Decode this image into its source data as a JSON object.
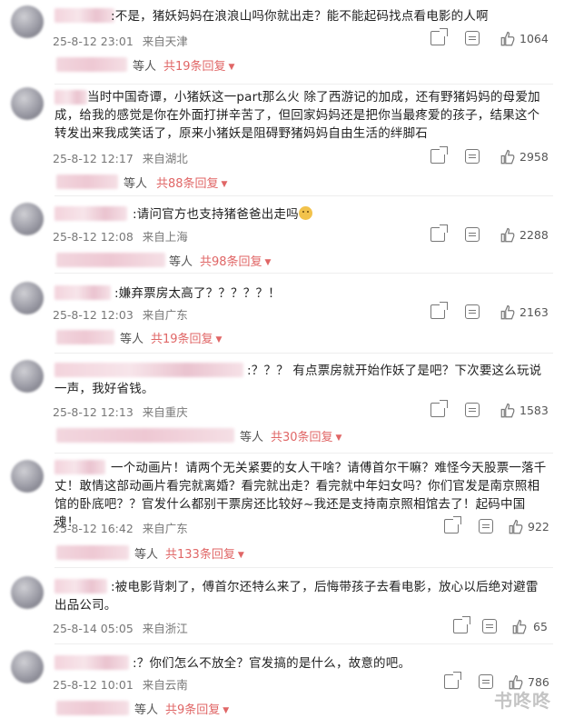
{
  "reply_others_label": "等人",
  "watermark": "书咚咚",
  "comments": [
    {
      "text": ":不是，猪妖妈妈在浪浪山吗你就出走？能不能起码找点看电影的人啊",
      "date": "25-8-12 23:01",
      "location": "来自天津",
      "likes": "1064",
      "replies": "共19条回复"
    },
    {
      "text": "当时中国奇谭，小猪妖这一part那么火 除了西游记的加成，还有野猪妈妈的母爱加成，给我的感觉是你在外面打拼辛苦了，但回家妈妈还是把你当最疼爱的孩子，结果这个转发出来我成笑话了，原来小猪妖是阻碍野猪妈妈自由生活的绊脚石",
      "date": "25-8-12 12:17",
      "location": "来自湖北",
      "likes": "2958",
      "replies": "共88条回复"
    },
    {
      "text": ":请问官方也支持猪爸爸出走吗",
      "date": "25-8-12 12:08",
      "location": "来自上海",
      "likes": "2288",
      "replies": "共98条回复"
    },
    {
      "text": ":嫌弃票房太高了？？？？？！",
      "date": "25-8-12 12:03",
      "location": "来自广东",
      "likes": "2163",
      "replies": "共19条回复"
    },
    {
      "text": ":？？？ 有点票房就开始作妖了是吧？下次要这么玩说一声，我好省钱。",
      "date": "25-8-12 12:13",
      "location": "来自重庆",
      "likes": "1583",
      "replies": "共30条回复"
    },
    {
      "text": "一个动画片！请两个无关紧要的女人干啥？请傅首尔干嘛？难怪今天股票一落千丈！敢情这部动画片看完就离婚？看完就出走？看完就中年妇女吗？你们官发是南京照相馆的卧底吧？？官发什么都别干票房还比较好~我还是支持南京照相馆去了！起码中国魂！",
      "date": "25-8-12 16:42",
      "location": "来自广东",
      "likes": "922",
      "replies": "共133条回复"
    },
    {
      "text": ":被电影背刺了，傅首尔还特么来了，后悔带孩子去看电影，放心以后绝对避雷出品公司。",
      "date": "25-8-14 05:05",
      "location": "来自浙江",
      "likes": "65",
      "replies": ""
    },
    {
      "text": ":？你们怎么不放全？官发搞的是什么，故意的吧。",
      "date": "25-8-12 10:01",
      "location": "来自云南",
      "likes": "786",
      "replies": "共9条回复"
    }
  ]
}
